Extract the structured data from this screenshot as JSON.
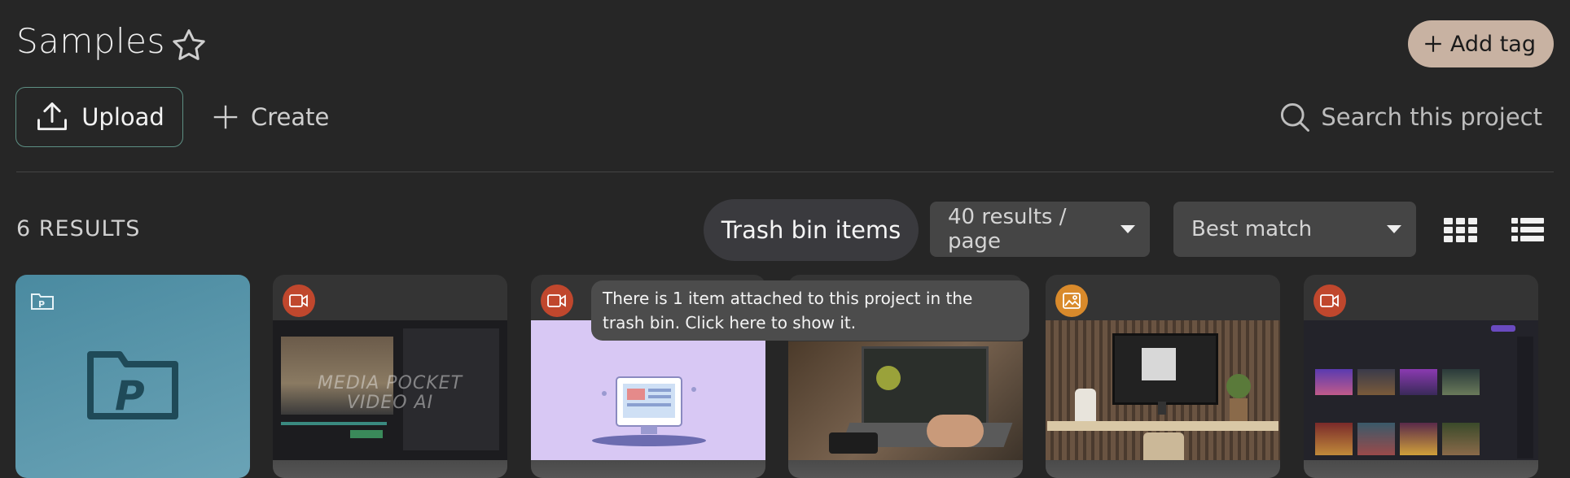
{
  "header": {
    "title": "Samples",
    "add_tag_label": "Add tag"
  },
  "toolbar": {
    "upload_label": "Upload",
    "create_label": "Create",
    "search_placeholder": "Search this project"
  },
  "results_bar": {
    "count_label": "6 RESULTS",
    "trash_button_label": "Trash bin items",
    "per_page_value": "40 results / page",
    "sort_value": "Best match"
  },
  "tooltip": {
    "text": "There is 1 item attached to this project in the trash bin. Click here to show it."
  },
  "cards": [
    {
      "type": "project-folder",
      "icon": "project-folder-icon"
    },
    {
      "type": "video",
      "icon": "video-camera-icon",
      "overlay_text": [
        "MEDIA POCKET",
        "VIDEO AI"
      ]
    },
    {
      "type": "video",
      "icon": "video-camera-icon"
    },
    {
      "type": "video",
      "icon": "video-camera-icon"
    },
    {
      "type": "image",
      "icon": "image-icon"
    },
    {
      "type": "video",
      "icon": "video-camera-icon"
    }
  ],
  "colors": {
    "background": "#262626",
    "accent_tag": "#c8b2a2",
    "upload_border": "#5d8f83",
    "video_badge": "#c0472d",
    "image_badge": "#d98a2b",
    "folder_card": "#4d8ea3"
  }
}
